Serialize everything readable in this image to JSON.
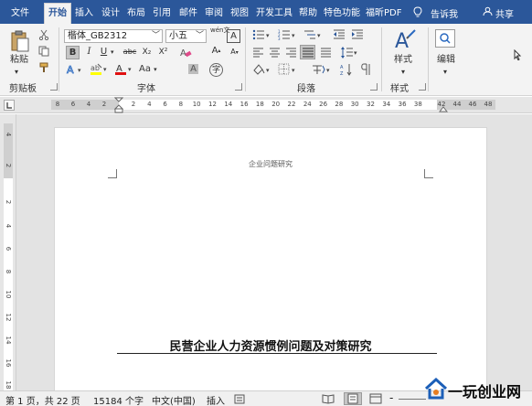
{
  "tabs": {
    "file": "文件",
    "home": "开始",
    "insert": "插入",
    "design": "设计",
    "layout": "布局",
    "references": "引用",
    "mailings": "邮件",
    "review": "审阅",
    "view": "视图",
    "developer": "开发工具",
    "help": "帮助",
    "special": "特色功能",
    "foxit": "福昕PDF",
    "tellme": "告诉我",
    "share": "共享"
  },
  "ribbon": {
    "paste_label": "粘贴",
    "clipboard_group": "剪贴板",
    "font_group": "字体",
    "paragraph_group": "段落",
    "styles_group": "样式",
    "styles_label": "样式",
    "editing_label": "编辑",
    "font_name": "楷体_GB2312",
    "font_size": "小五",
    "bold": "B",
    "italic": "I",
    "underline": "U",
    "strike": "abc",
    "subscript": "X₂",
    "superscript": "X²",
    "grow_font": "A",
    "shrink_font": "A",
    "case": "Aa",
    "wen": "wén文",
    "char_border": "A",
    "char_shade": "A",
    "circle_char": "字"
  },
  "ruler": {
    "h_left": [
      "8",
      "6",
      "4",
      "2"
    ],
    "h_marks": [
      "2",
      "4",
      "6",
      "8",
      "10",
      "12",
      "14",
      "16",
      "18",
      "20",
      "22",
      "24",
      "26",
      "28",
      "30",
      "32",
      "34",
      "36",
      "38"
    ],
    "h_right": [
      "42",
      "44",
      "46",
      "48"
    ],
    "v_marks": [
      "4",
      "2",
      "2",
      "4",
      "6",
      "8",
      "10",
      "12",
      "14",
      "16",
      "18"
    ]
  },
  "document": {
    "header": "企业问题研究",
    "title": "民营企业人力资源惯例问题及对策研究"
  },
  "status": {
    "page": "第 1 页，共 22 页",
    "words": "15184 个字",
    "language": "中文(中国)",
    "mode": "插入",
    "zoom_minus": "-"
  },
  "watermark": {
    "text": "一玩创业网"
  },
  "colors": {
    "title_bar": "#2b579a",
    "ribbon_bg": "#f3f3f3",
    "highlight_yellow": "#ffff00",
    "font_red": "#e01010"
  }
}
